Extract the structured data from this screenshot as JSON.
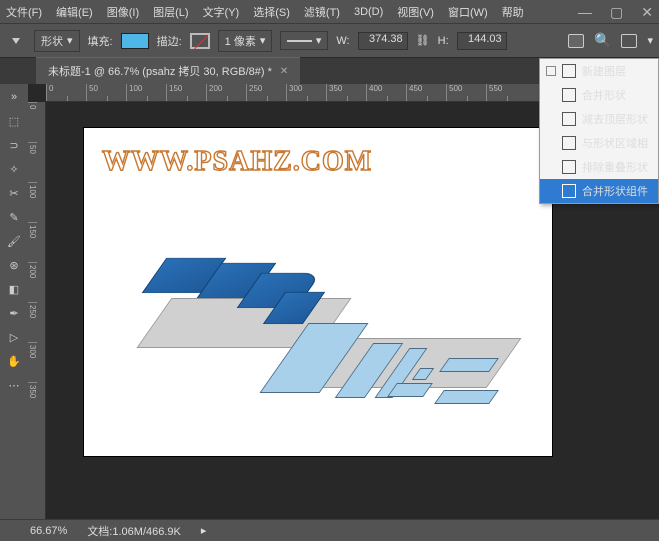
{
  "menu": {
    "file": "文件(F)",
    "edit": "编辑(E)",
    "image": "图像(I)",
    "layer": "图层(L)",
    "type": "文字(Y)",
    "select": "选择(S)",
    "filter": "滤镜(T)",
    "d3": "3D(D)",
    "view": "视图(V)",
    "window": "窗口(W)",
    "help": "帮助"
  },
  "opt": {
    "shape": "形状",
    "fill": "填充:",
    "stroke": "描边:",
    "strokew": "1 像素",
    "wlabel": "W:",
    "wval": "374.38",
    "hlabel": "H:",
    "hval": "144.03"
  },
  "tab": {
    "title": "未标题-1 @ 66.7% (psahz 拷贝 30, RGB/8#) *"
  },
  "canvas": {
    "watermark": "WWW.PSAHZ.COM"
  },
  "pathmenu": {
    "i0": "新建图层",
    "i1": "合并形状",
    "i2": "减去顶层形状",
    "i3": "与形状区域相",
    "i4": "排除重叠形状",
    "i5": "合并形状组件"
  },
  "status": {
    "zoom": "66.67%",
    "doc": "文档:1.06M/466.9K"
  },
  "ruler": {
    "h": [
      "0",
      "50",
      "100",
      "150",
      "200",
      "250",
      "300",
      "350",
      "400",
      "450",
      "500",
      "550"
    ],
    "v": [
      "0",
      "50",
      "100",
      "150",
      "200",
      "250",
      "300",
      "350"
    ]
  }
}
